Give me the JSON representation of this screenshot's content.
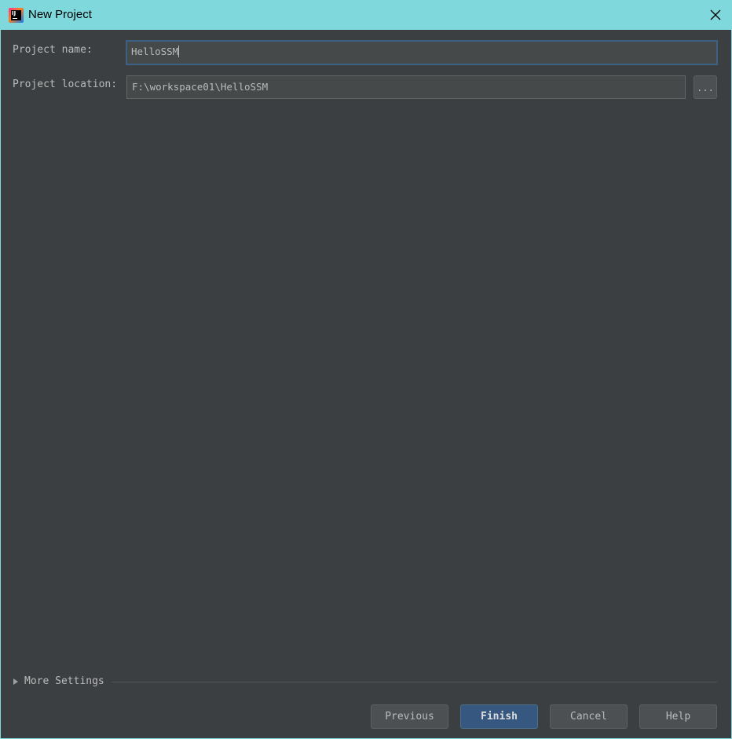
{
  "window": {
    "title": "New Project"
  },
  "form": {
    "project_name_label": "Project name:",
    "project_name_value": "HelloSSM",
    "project_location_label": "Project location:",
    "project_location_value": "F:\\workspace01\\HelloSSM",
    "browse_label": "..."
  },
  "more_settings": {
    "label": "More Settings"
  },
  "buttons": {
    "previous": "Previous",
    "finish": "Finish",
    "cancel": "Cancel",
    "help": "Help"
  },
  "colors": {
    "titlebar": "#7fd9dc",
    "background": "#3c3f41",
    "field_bg": "#45494a",
    "focus_border": "#3d6185",
    "default_button": "#365880",
    "text": "#bbbbbb"
  },
  "icons": {
    "app": "intellij-idea-icon",
    "close": "close-icon",
    "expand": "triangle-right-icon"
  }
}
